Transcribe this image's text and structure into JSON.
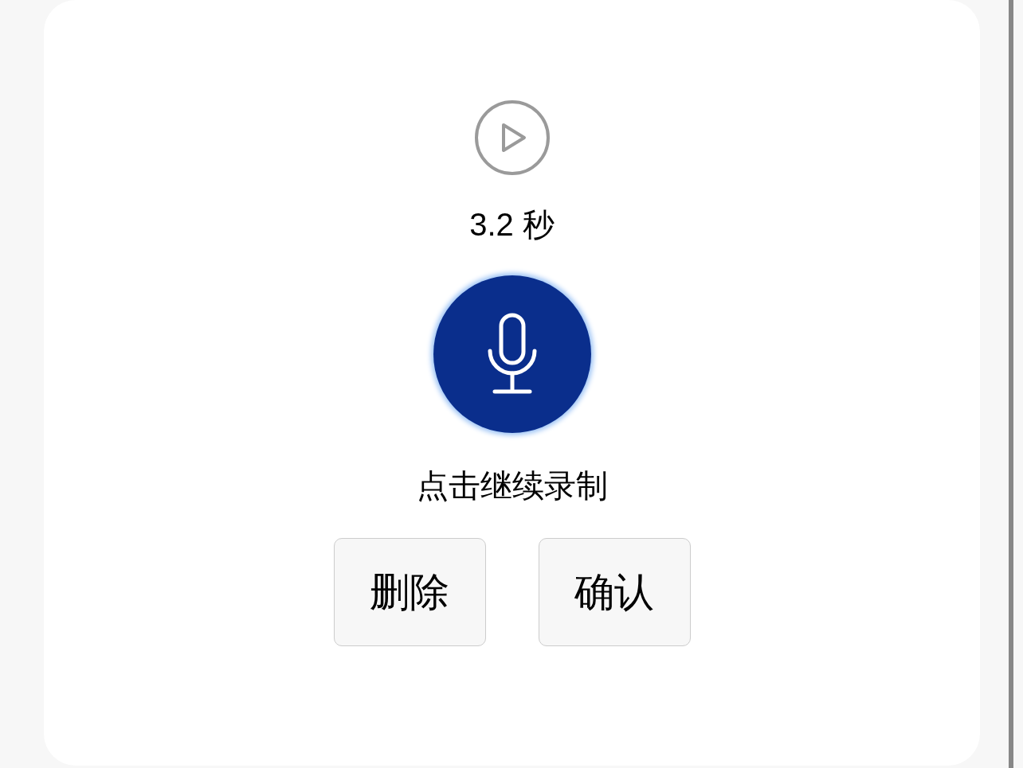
{
  "recorder": {
    "duration": "3.2 秒",
    "hint": "点击继续录制",
    "buttons": [
      {
        "label": "删除"
      },
      {
        "label": "确认"
      }
    ]
  }
}
